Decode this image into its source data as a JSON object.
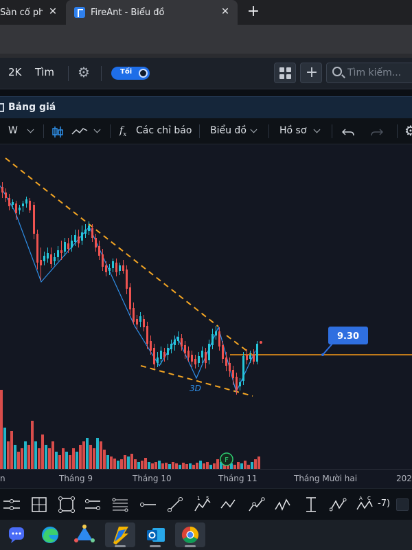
{
  "browser": {
    "tabs": [
      {
        "title": "Sàn cổ phiế",
        "active": false
      },
      {
        "title": "FireAnt - Biểu đồ",
        "active": true
      }
    ],
    "close_glyph": "✕",
    "new_tab_glyph": "+"
  },
  "app_header": {
    "btn_2k": "2K",
    "btn_tim": "Tìm",
    "theme_toggle_label": "Tối",
    "search_placeholder": "Tìm kiếm...",
    "icons": [
      "gear-icon",
      "grid-icon",
      "plus-icon",
      "search-icon"
    ]
  },
  "panel": {
    "title": "Bảng giá"
  },
  "chart_toolbar": {
    "interval": "W",
    "indicators_label": "Các chỉ báo",
    "chart_type_label": "Biểu đồ",
    "profile_label": "Hồ sơ",
    "icons": [
      "candle-icon",
      "line-style-icon",
      "fx-icon",
      "undo-icon",
      "redo-icon",
      "settings-icon"
    ]
  },
  "chart_data": {
    "type": "candlestick",
    "price_label": "9.30",
    "pattern_label": "3D",
    "event_marker": "F",
    "x_tick_labels": [
      "n",
      "Tháng 9",
      "Tháng 10",
      "Tháng 11",
      "Tháng Mười hai",
      "202"
    ],
    "colors": {
      "up": "#26c6da",
      "down": "#ef5350",
      "trendline": "#f5a623",
      "zigzag": "#2f8fe8",
      "price_line": "#c07a1a",
      "price_badge": "#2f6fe0"
    }
  },
  "drawing_tools": {
    "partial_label": "-7)",
    "fib_labels": [
      "1",
      "5",
      "A",
      "C"
    ]
  },
  "taskbar": {
    "apps": [
      "chat-icon",
      "edge-icon",
      "network-icon",
      "fireant-icon",
      "outlook-icon",
      "chrome-icon"
    ]
  }
}
